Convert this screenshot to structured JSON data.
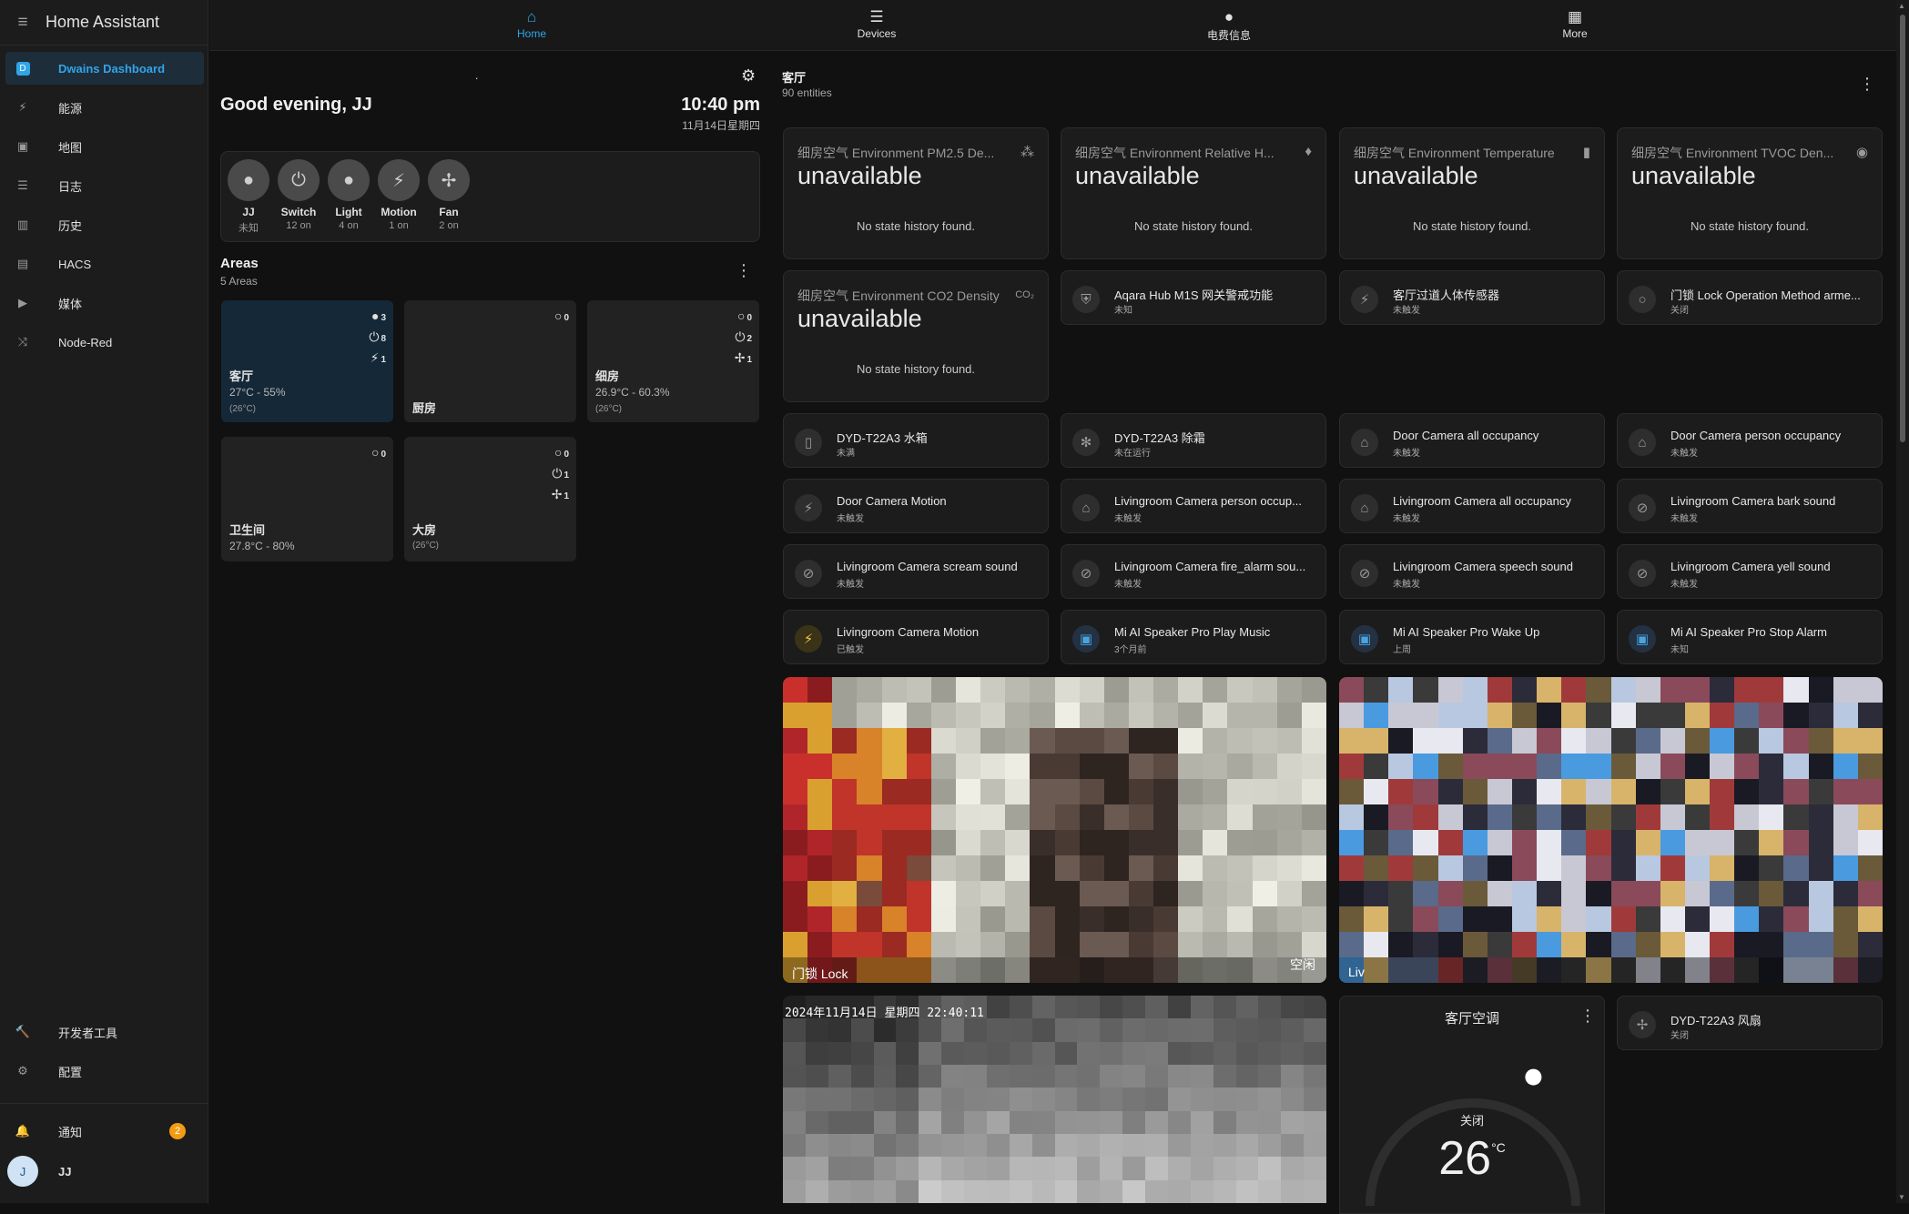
{
  "app": {
    "title": "Home Assistant"
  },
  "sidebar": {
    "items": [
      {
        "name": "sidebar-item-dwains-dashboard",
        "label": "Dwains Dashboard",
        "icon": "dashboard-icon",
        "active": true
      },
      {
        "name": "sidebar-item-energy",
        "label": "能源",
        "icon": "lightning-icon"
      },
      {
        "name": "sidebar-item-map",
        "label": "地图",
        "icon": "map-icon"
      },
      {
        "name": "sidebar-item-logbook",
        "label": "日志",
        "icon": "list-icon"
      },
      {
        "name": "sidebar-item-history",
        "label": "历史",
        "icon": "chart-icon"
      },
      {
        "name": "sidebar-item-hacs",
        "label": "HACS",
        "icon": "hacs-icon"
      },
      {
        "name": "sidebar-item-media",
        "label": "媒体",
        "icon": "play-icon"
      },
      {
        "name": "sidebar-item-node-red",
        "label": "Node-Red",
        "icon": "shuffle-icon"
      }
    ],
    "dev_tools": "开发者工具",
    "settings": "配置",
    "notifications": "通知",
    "notifications_count": "2",
    "user": "JJ",
    "user_initial": "J"
  },
  "topnav": {
    "tabs": [
      {
        "label": "Home",
        "active": true
      },
      {
        "label": "Devices"
      },
      {
        "label": "电费信息"
      },
      {
        "label": "More"
      }
    ]
  },
  "greeting": {
    "text": "Good evening, JJ",
    "time": "10:40 pm",
    "date": "11月14日星期四",
    "dot": "."
  },
  "people_chips": [
    {
      "name": "JJ",
      "status": "未知"
    },
    {
      "name": "Switch",
      "status": "12 on"
    },
    {
      "name": "Light",
      "status": "4 on"
    },
    {
      "name": "Motion",
      "status": "1 on"
    },
    {
      "name": "Fan",
      "status": "2 on"
    }
  ],
  "areas": {
    "title": "Areas",
    "subtitle": "5 Areas",
    "list": [
      {
        "name": "客厅",
        "temp": "27°C - 55%",
        "setpoint": "(26°C)",
        "counts": [
          "3",
          "8",
          "1"
        ]
      },
      {
        "name": "厨房",
        "temp": "",
        "setpoint": "",
        "counts": [
          "0"
        ]
      },
      {
        "name": "细房",
        "temp": "26.9°C - 60.3%",
        "setpoint": "(26°C)",
        "counts": [
          "0",
          "2",
          "1"
        ]
      },
      {
        "name": "卫生间",
        "temp": "27.8°C - 80%",
        "setpoint": "",
        "counts": [
          "0"
        ]
      },
      {
        "name": "大房",
        "temp": "",
        "setpoint": "(26°C)",
        "counts": [
          "0",
          "1",
          "1"
        ]
      }
    ]
  },
  "room": {
    "title": "客厅",
    "entities": "90 entities"
  },
  "sensors": [
    {
      "name": "细房空气 Environment PM2.5 De...",
      "value": "unavailable",
      "history": "No state history found."
    },
    {
      "name": "细房空气 Environment Relative H...",
      "value": "unavailable",
      "history": "No state history found."
    },
    {
      "name": "细房空气 Environment Temperature",
      "value": "unavailable",
      "history": "No state history found."
    },
    {
      "name": "细房空气 Environment TVOC Den...",
      "value": "unavailable",
      "history": "No state history found."
    },
    {
      "name": "细房空气 Environment CO2 Density",
      "value": "unavailable",
      "history": "No state history found."
    }
  ],
  "entities": [
    {
      "name": "Aqara Hub M1S 网关警戒功能",
      "state": "未知"
    },
    {
      "name": "客厅过道人体传感器",
      "state": "未触发"
    },
    {
      "name": "门锁 Lock Operation Method arme...",
      "state": "关闭"
    },
    {
      "name": "DYD-T22A3 水箱",
      "state": "未满"
    },
    {
      "name": "DYD-T22A3 除霜",
      "state": "未在运行"
    },
    {
      "name": "Door Camera all occupancy",
      "state": "未触发"
    },
    {
      "name": "Door Camera person occupancy",
      "state": "未触发"
    },
    {
      "name": "Door Camera Motion",
      "state": "未触发"
    },
    {
      "name": "Livingroom Camera person occup...",
      "state": "未触发"
    },
    {
      "name": "Livingroom Camera all occupancy",
      "state": "未触发"
    },
    {
      "name": "Livingroom Camera bark sound",
      "state": "未触发"
    },
    {
      "name": "Livingroom Camera scream sound",
      "state": "未触发"
    },
    {
      "name": "Livingroom Camera fire_alarm sou...",
      "state": "未触发"
    },
    {
      "name": "Livingroom Camera speech sound",
      "state": "未触发"
    },
    {
      "name": "Livingroom Camera yell sound",
      "state": "未触发"
    },
    {
      "name": "Livingroom Camera Motion",
      "state": "已触发"
    },
    {
      "name": "Mi AI Speaker Pro Play Music",
      "state": "3个月前"
    },
    {
      "name": "Mi AI Speaker Pro Wake Up",
      "state": "上周"
    },
    {
      "name": "Mi AI Speaker Pro Stop Alarm",
      "state": "未知"
    },
    {
      "name": "DYD-T22A3 风扇",
      "state": "关闭"
    }
  ],
  "cameras": [
    {
      "label": "门锁 Lock",
      "state": "空闲"
    },
    {
      "label": "Liv",
      "state": ""
    },
    {
      "timestamp": "2024年11月14日 星期四 22:40:11"
    }
  ],
  "thermostat": {
    "title": "客厅空调",
    "mode": "关闭",
    "temp": "26",
    "unit": "°C",
    "level": 0.5
  }
}
